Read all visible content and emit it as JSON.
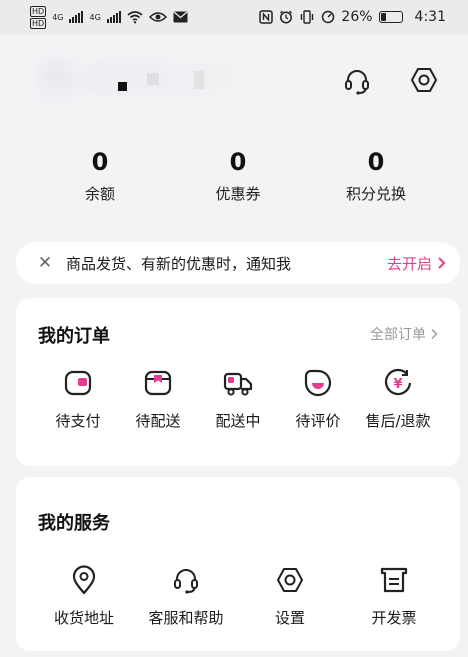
{
  "status_bar": {
    "left_badges": [
      "HD",
      "HD"
    ],
    "network_labels": [
      "4G",
      "4G"
    ],
    "battery_percent": "26%",
    "battery_level": 0.26,
    "time": "4:31"
  },
  "header": {
    "icons": [
      "headset-icon",
      "settings-icon"
    ]
  },
  "stats": [
    {
      "value": "0",
      "label": "余额"
    },
    {
      "value": "0",
      "label": "优惠券"
    },
    {
      "value": "0",
      "label": "积分兑换"
    }
  ],
  "notice": {
    "text": "商品发货、有新的优惠时，通知我",
    "action": "去开启",
    "close_glyph": "✕"
  },
  "orders": {
    "title": "我的订单",
    "all_link": "全部订单",
    "items": [
      {
        "label": "待支付",
        "icon": "wallet-icon"
      },
      {
        "label": "待配送",
        "icon": "package-icon"
      },
      {
        "label": "配送中",
        "icon": "truck-icon"
      },
      {
        "label": "待评价",
        "icon": "review-icon"
      },
      {
        "label": "售后/退款",
        "icon": "refund-icon"
      }
    ]
  },
  "services": {
    "title": "我的服务",
    "items": [
      {
        "label": "收货地址",
        "icon": "location-pin-icon"
      },
      {
        "label": "客服和帮助",
        "icon": "headset-icon"
      },
      {
        "label": "设置",
        "icon": "settings-icon"
      },
      {
        "label": "开发票",
        "icon": "invoice-icon"
      }
    ]
  },
  "colors": {
    "accent": "#e23d8f",
    "background": "#f3f3f5",
    "card": "#ffffff"
  }
}
